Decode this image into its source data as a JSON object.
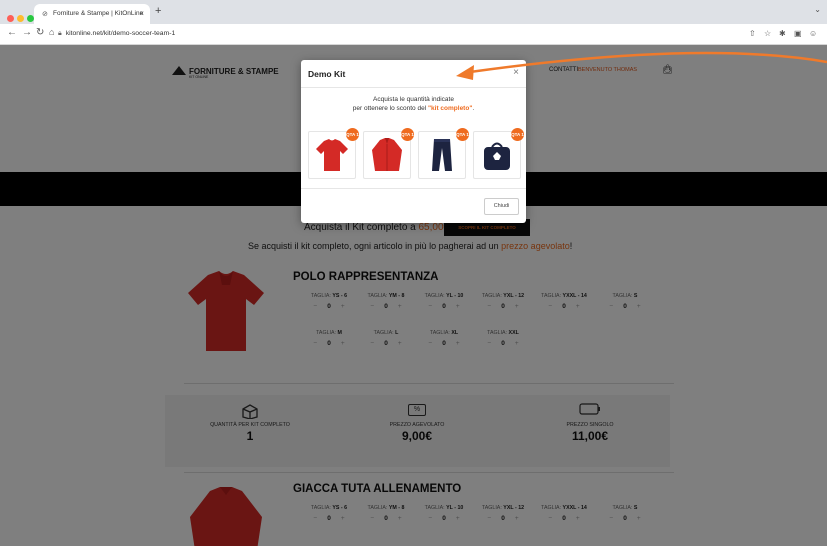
{
  "browser": {
    "tab_title": "Forniture & Stampe | KitOnLine",
    "url": "kitonline.net/kit/demo-soccer-team-1",
    "new_tab": "+",
    "tab_close": "×"
  },
  "header": {
    "logo_text": "FORNITURE & STAMPE",
    "logo_sub": "KIT ONLINE",
    "contatti": "CONTATTI",
    "user": "BENVENUTO THOMAS"
  },
  "promo": {
    "line1_prefix": "Acquista il Kit completo a",
    "line1_price": "65,00€",
    "button": "SCOPRI IL KIT COMPLETO",
    "line2_prefix": "Se acquisti il kit completo, ogni articolo in più lo pagherai ad un",
    "line2_highlight": "prezzo agevolato",
    "line2_suffix": "!"
  },
  "products": [
    {
      "name": "POLO RAPPRESENTANZA",
      "sizes": [
        {
          "label": "TAGLIA:",
          "size": "YS - 6",
          "qty": "0"
        },
        {
          "label": "TAGLIA:",
          "size": "YM - 8",
          "qty": "0"
        },
        {
          "label": "TAGLIA:",
          "size": "YL - 10",
          "qty": "0"
        },
        {
          "label": "TAGLIA:",
          "size": "YXL - 12",
          "qty": "0"
        },
        {
          "label": "TAGLIA:",
          "size": "YXXL - 14",
          "qty": "0"
        },
        {
          "label": "TAGLIA:",
          "size": "S",
          "qty": "0"
        },
        {
          "label": "TAGLIA:",
          "size": "M",
          "qty": "0"
        },
        {
          "label": "TAGLIA:",
          "size": "L",
          "qty": "0"
        },
        {
          "label": "TAGLIA:",
          "size": "XL",
          "qty": "0"
        },
        {
          "label": "TAGLIA:",
          "size": "XXL",
          "qty": "0"
        }
      ]
    },
    {
      "name": "GIACCA TUTA ALLENAMENTO",
      "sizes": [
        {
          "label": "TAGLIA:",
          "size": "YS - 6",
          "qty": "0"
        },
        {
          "label": "TAGLIA:",
          "size": "YM - 8",
          "qty": "0"
        },
        {
          "label": "TAGLIA:",
          "size": "YL - 10",
          "qty": "0"
        },
        {
          "label": "TAGLIA:",
          "size": "YXL - 12",
          "qty": "0"
        },
        {
          "label": "TAGLIA:",
          "size": "YXXL - 14",
          "qty": "0"
        },
        {
          "label": "TAGLIA:",
          "size": "S",
          "qty": "0"
        }
      ]
    }
  ],
  "stepper": {
    "minus": "−",
    "plus": "+"
  },
  "info": {
    "kit_qty_label": "QUANTITÀ PER KIT COMPLETO",
    "kit_qty_value": "1",
    "discount_label": "PREZZO AGEVOLATO",
    "discount_value": "9,00€",
    "single_label": "PREZZO SINGOLO",
    "single_value": "11,00€",
    "discount_icon_text": "%"
  },
  "modal": {
    "title": "Demo Kit",
    "close": "×",
    "msg_line1": "Acquista le quantità indicate",
    "msg_line2_prefix": "per ottenere lo sconto del",
    "msg_kit": "\"kit completo\"",
    "msg_line2_suffix": ".",
    "items": [
      {
        "name": "polo-red",
        "badge": "QTA 1"
      },
      {
        "name": "jacket-red",
        "badge": "QTA 1"
      },
      {
        "name": "pants-navy",
        "badge": "QTA 1"
      },
      {
        "name": "bag-navy",
        "badge": "QTA 1"
      }
    ],
    "close_button": "Chiudi"
  },
  "colors": {
    "accent": "#ef6b1f",
    "product_red": "#d42a26",
    "navy": "#1d2440"
  }
}
